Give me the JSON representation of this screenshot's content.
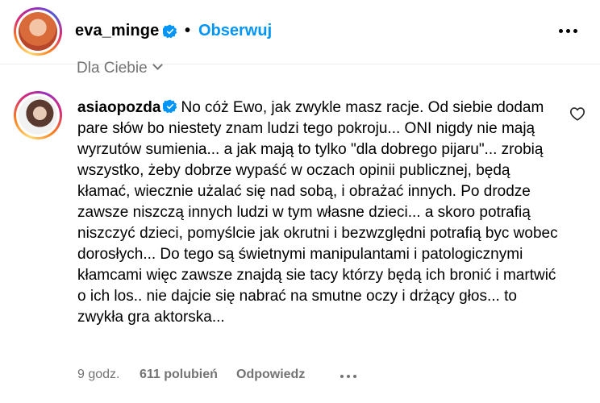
{
  "post_header": {
    "username": "eva_minge",
    "separator": "•",
    "follow_label": "Obserwuj",
    "verified_icon": "verified-badge-icon",
    "more_icon": "more-options-icon"
  },
  "filter": {
    "label": "Dla Ciebie",
    "icon": "chevron-down-icon"
  },
  "comment": {
    "username": "asiaopozda",
    "verified_icon": "verified-badge-icon",
    "text": "No cóż Ewo, jak zwykle masz racje. Od siebie dodam pare słów bo niestety znam ludzi tego pokroju... ONI nigdy nie mają wyrzutów sumienia... a jak mają to tylko \"dla dobrego pijaru\"... zrobią wszystko, żeby dobrze wypaść w oczach opinii publicznej, będą kłamać, wiecznie użalać się nad sobą, i obrażać innych. Po drodze zawsze niszczą innych ludzi w tym własne dzieci... a skoro potrafią niszczyć dzieci, pomyślcie jak okrutni i bezwzględni potrafią byc wobec dorosłych... Do tego są świetnymi manipulantami i patologicznymi kłamcami więc zawsze znajdą sie tacy którzy będą ich bronić i martwić o ich los.. nie dajcie się nabrać na smutne oczy i drżący głos... to zwykła gra aktorska...",
    "time": "9 godz.",
    "likes": "611 polubień",
    "reply_label": "Odpowiedz",
    "like_icon": "heart-outline-icon",
    "more_icon": "more-options-icon"
  },
  "colors": {
    "link_blue": "#0095f6",
    "verified_blue": "#0095f6",
    "secondary_text": "#737373"
  }
}
